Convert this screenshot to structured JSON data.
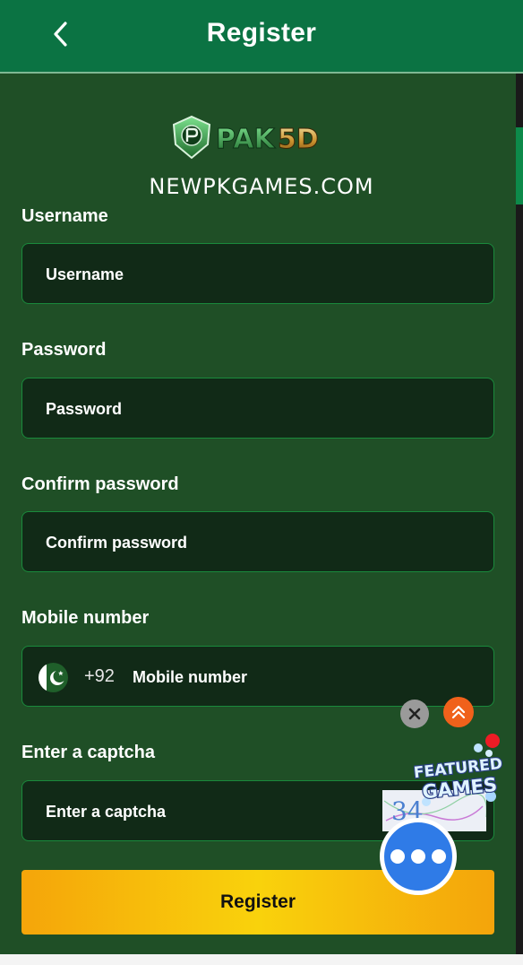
{
  "header": {
    "title": "Register"
  },
  "logo": {
    "text": "PAK5D"
  },
  "domain": "NEWPKGAMES.COM",
  "form": {
    "username": {
      "label": "Username",
      "placeholder": "Username"
    },
    "password": {
      "label": "Password",
      "placeholder": "Password"
    },
    "confirm_password": {
      "label": "Confirm password",
      "placeholder": "Confirm password"
    },
    "mobile": {
      "label": "Mobile number",
      "prefix": "+92",
      "placeholder": "Mobile number"
    },
    "captcha": {
      "label": "Enter a captcha",
      "placeholder": "Enter a captcha",
      "image_text": "34"
    },
    "submit_label": "Register"
  },
  "floating": {
    "featured_text": "FEATURED GAMES"
  },
  "colors": {
    "header_bg": "#0b7343",
    "page_bg": "#1f4f26",
    "field_bg": "#112a17",
    "field_border": "#1a8a3c",
    "button_gradient": [
      "#f5a50a",
      "#f9d20c"
    ]
  }
}
